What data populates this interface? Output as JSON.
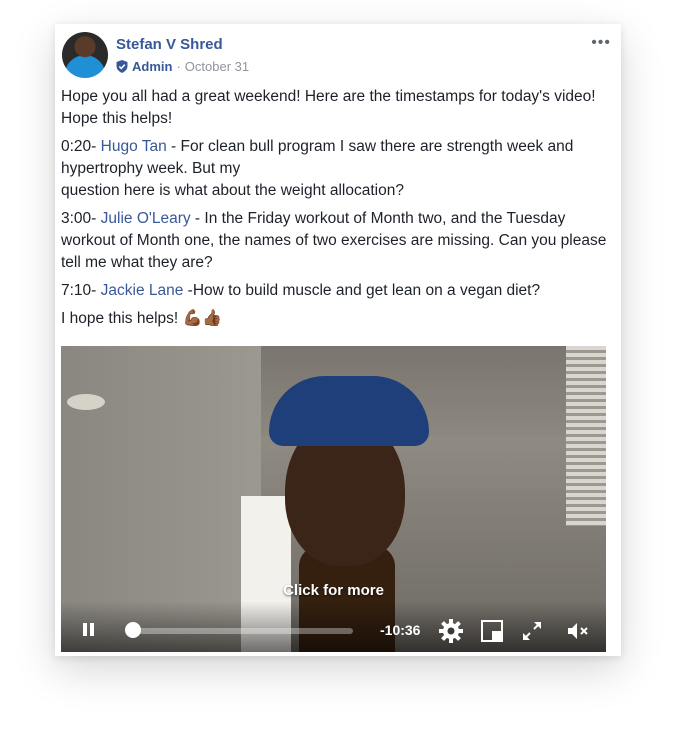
{
  "post": {
    "author": "Stefan V Shred",
    "role": "Admin",
    "separator": "·",
    "date": "October 31",
    "more": "•••",
    "paragraphs": [
      {
        "lead": "Hope you all had a great weekend! Here are the timestamps for today's video! Hope this helps!"
      },
      {
        "timestamp": "0:20- ",
        "name": "Hugo Tan",
        "text": " - For clean bull program I saw there are strength week and hypertrophy week. But my",
        "text2": "question here is what about the weight allocation?"
      },
      {
        "timestamp": "3:00- ",
        "name": "Julie O'Leary",
        "text": " - In the Friday workout of Month two, and the Tuesday workout of Month one, the names of two exercises are missing. Can you please tell me what they are?"
      },
      {
        "timestamp": "7:10- ",
        "name": "Jackie Lane",
        "text": " -How to build muscle and get lean on a vegan diet?"
      },
      {
        "lead": "I hope this helps! ",
        "emoji": "💪🏾👍🏾"
      }
    ]
  },
  "video": {
    "cta": "Click for more",
    "time_remaining": "-10:36",
    "progress": 0.02,
    "controls": {
      "pause": "pause-icon",
      "settings": "gear-icon",
      "pip": "picture-in-picture-icon",
      "fullscreen": "expand-icon",
      "mute": "muted-speaker-icon"
    }
  },
  "colors": {
    "link": "#385898",
    "text": "#1d2129",
    "meta": "#90949c"
  }
}
